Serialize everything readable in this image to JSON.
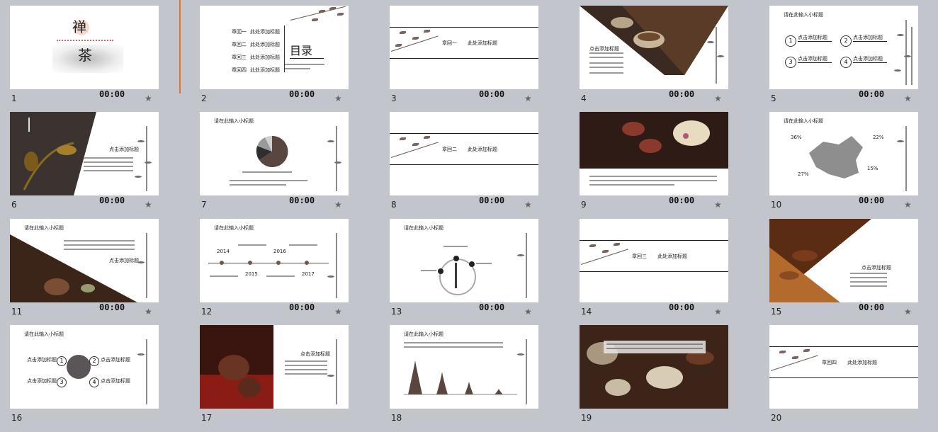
{
  "slides": [
    {
      "number": "1",
      "duration": "00:00",
      "title_top": "禅",
      "title_bottom": "茶"
    },
    {
      "number": "2",
      "duration": "00:00",
      "heading": "目录",
      "items": [
        "章回一",
        "章回二",
        "章回三",
        "章回四"
      ],
      "item_text": "此处添加标题"
    },
    {
      "number": "3",
      "duration": "00:00",
      "chapter": "章回一",
      "chapter_title": "此处添加标题"
    },
    {
      "number": "4",
      "duration": "00:00",
      "label": "点击添加标题"
    },
    {
      "number": "5",
      "duration": "00:00",
      "subtitle": "请在此输入小标题",
      "badges": [
        "1",
        "2",
        "3",
        "4"
      ],
      "item_text": "点击添加标题"
    },
    {
      "number": "6",
      "duration": "00:00",
      "label": "点击添加标题"
    },
    {
      "number": "7",
      "duration": "00:00",
      "subtitle": "请在此输入小标题"
    },
    {
      "number": "8",
      "duration": "00:00",
      "chapter": "章回二",
      "chapter_title": "此处添加标题"
    },
    {
      "number": "9",
      "duration": "00:00"
    },
    {
      "number": "10",
      "duration": "00:00",
      "subtitle": "请在此输入小标题",
      "percents": [
        "36%",
        "22%",
        "27%",
        "15%"
      ]
    },
    {
      "number": "11",
      "duration": "00:00",
      "subtitle": "请在此输入小标题",
      "label": "点击添加标题"
    },
    {
      "number": "12",
      "duration": "00:00",
      "subtitle": "请在此输入小标题",
      "years": [
        "2014",
        "2015",
        "2016",
        "2017"
      ]
    },
    {
      "number": "13",
      "duration": "00:00",
      "subtitle": "请在此输入小标题"
    },
    {
      "number": "14",
      "duration": "00:00",
      "chapter": "章回三",
      "chapter_title": "此处添加标题"
    },
    {
      "number": "15",
      "duration": "00:00",
      "label": "点击添加标题"
    },
    {
      "number": "16",
      "subtitle": "请在此输入小标题",
      "badges": [
        "1",
        "2",
        "3",
        "4"
      ],
      "item_text": "点击添加标题"
    },
    {
      "number": "17",
      "label": "点击添加标题"
    },
    {
      "number": "18",
      "subtitle": "请在此输入小标题"
    },
    {
      "number": "19"
    },
    {
      "number": "20",
      "chapter": "章回四",
      "chapter_title": "此处添加标题"
    }
  ],
  "icons": {
    "star": "star-icon"
  },
  "colors": {
    "background": "#c3c5cd",
    "accent": "#e8722a",
    "chart_dark": "#5a4641"
  }
}
